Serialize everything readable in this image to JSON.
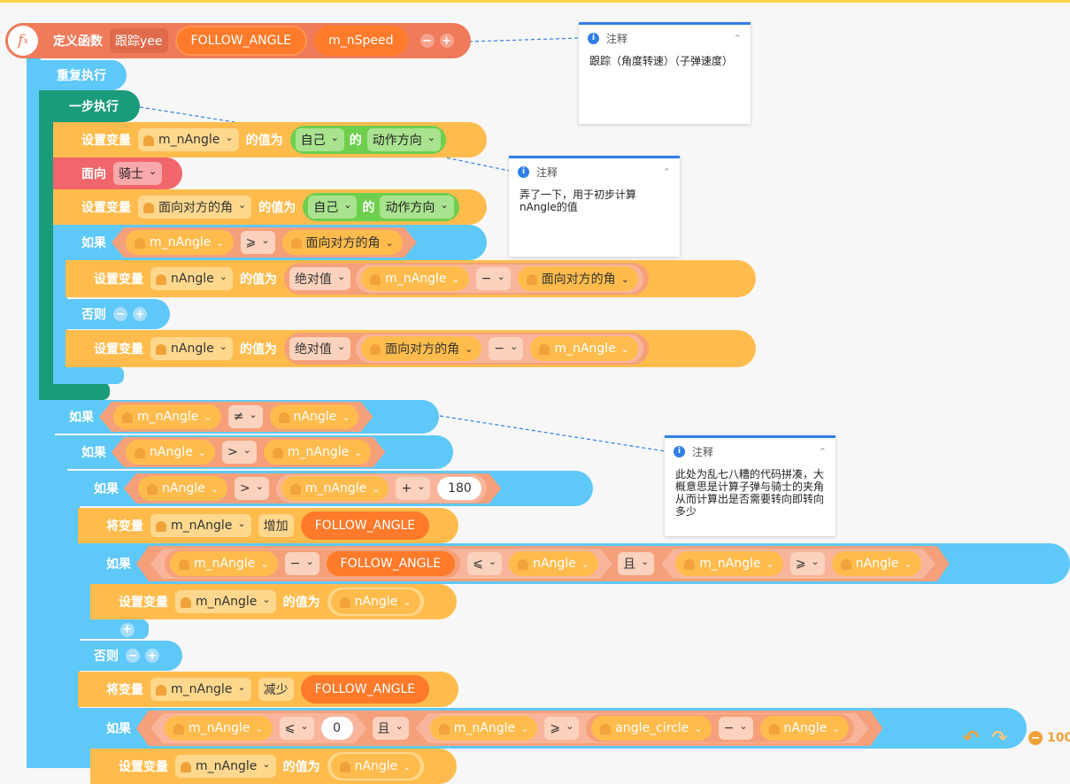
{
  "colors": {
    "function_define": "#ef7b5a",
    "loop": "#5ec8f8",
    "sequence": "#1a9b7a",
    "variable": "#ffbc4d",
    "sprite_action": "#f0666a",
    "sensing": "#6ecf4e",
    "param": "#ff7a2a",
    "canvas": "#f7f7f7",
    "comment_accent": "#2f7fe6"
  },
  "function": {
    "label": "定义函数",
    "name": "跟踪yee",
    "params": [
      "FOLLOW_ANGLE",
      "m_nSpeed"
    ]
  },
  "labels": {
    "repeat": "重复执行",
    "step": "一步执行",
    "set_var": "设置变量",
    "value_of": "的值为",
    "face": "面向",
    "if": "如果",
    "else": "否则",
    "change_var": "将变量",
    "of": "的",
    "and": "且"
  },
  "blocks": {
    "set1_var": "m_nAngle",
    "self": "自己",
    "direction": "动作方向",
    "face_target": "骑士",
    "set2_var": "面向对方的角",
    "if1": {
      "left": "m_nAngle",
      "op": "⩾",
      "right": "面向对方的角"
    },
    "abs": "绝对值",
    "set3": {
      "var": "nAngle",
      "a": "m_nAngle",
      "op": "−",
      "b": "面向对方的角"
    },
    "set4": {
      "var": "nAngle",
      "a": "面向对方的角",
      "op": "−",
      "b": "m_nAngle"
    },
    "if2": {
      "left": "m_nAngle",
      "op": "≠",
      "right": "nAngle"
    },
    "if3": {
      "left": "nAngle",
      "op": ">",
      "right": "m_nAngle"
    },
    "if4": {
      "left": "nAngle",
      "op": ">",
      "a": "m_nAngle",
      "plus": "+",
      "num": "180"
    },
    "change1": {
      "var": "m_nAngle",
      "op": "增加",
      "val": "FOLLOW_ANGLE"
    },
    "if5": {
      "a": "m_nAngle",
      "minus": "−",
      "b": "FOLLOW_ANGLE",
      "le": "⩽",
      "c": "nAngle",
      "d": "m_nAngle",
      "ge": "⩾",
      "e": "nAngle"
    },
    "set5": {
      "var": "m_nAngle",
      "val": "nAngle"
    },
    "change2": {
      "var": "m_nAngle",
      "op": "减少",
      "val": "FOLLOW_ANGLE"
    },
    "if6": {
      "a": "m_nAngle",
      "le": "⩽",
      "num": "0",
      "b": "m_nAngle",
      "ge": "⩾",
      "c": "angle_circle",
      "minus": "−",
      "d": "nAngle"
    },
    "set6": {
      "var": "m_nAngle",
      "val": "nAngle"
    }
  },
  "comments": [
    {
      "title": "注释",
      "body": "跟踪（角度转速）（子弹速度）"
    },
    {
      "title": "注释",
      "body": "弄了一下，用于初步计算nAngle的值"
    },
    {
      "title": "注释",
      "body": "此处为乱七八糟的代码拼凑，大概意思是计算子弹与骑士的夹角从而计算出是否需要转向即转向多少"
    }
  ],
  "zoom": "100"
}
